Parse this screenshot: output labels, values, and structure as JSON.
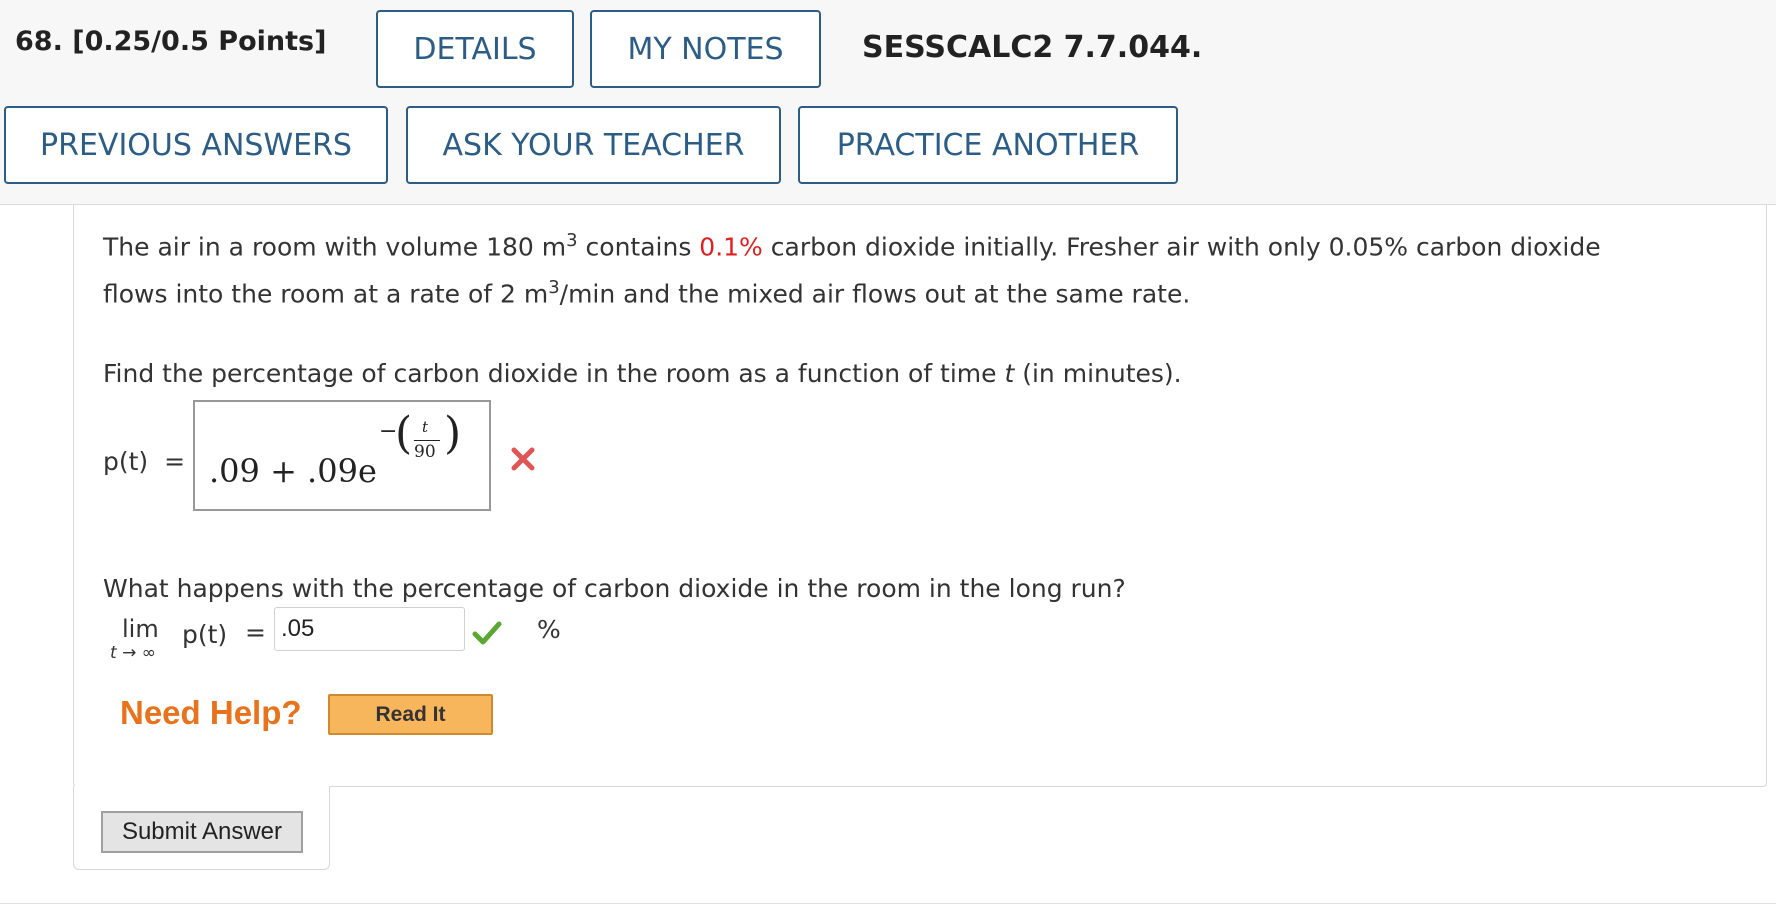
{
  "question": {
    "title": "68.  [0.25/0.5 Points]",
    "ref": "SESSCALC2 7.7.044."
  },
  "buttons": {
    "details": "DETAILS",
    "my_notes": "MY NOTES",
    "previous_answers": "PREVIOUS ANSWERS",
    "ask_teacher": "ASK YOUR TEACHER",
    "practice_another": "PRACTICE ANOTHER"
  },
  "problem": {
    "line1_a": "The air in a room with volume 180 m",
    "sup3": "3",
    "line1_b": " contains ",
    "initial_pct": "0.1%",
    "line1_c": " carbon dioxide initially. Fresher air with only 0.05% carbon dioxide",
    "line2_a": "flows into the room at a rate of 2 m",
    "line2_b": "/min and the mixed air flows out at the same rate."
  },
  "part1": {
    "prompt_a": "Find the percentage of carbon dioxide in the room as a function of time ",
    "prompt_t": "t",
    "prompt_b": " (in minutes).",
    "label": "p(t)",
    "equals": "=",
    "answer_base": ".09 + .09e",
    "exp_minus": "−",
    "exp_num": "t",
    "exp_den": "90",
    "status": "incorrect"
  },
  "part2": {
    "prompt": "What happens with the percentage of carbon dioxide in the room in the long run?",
    "lim": "lim",
    "lim_sub": "t → ∞",
    "func": "p(t)",
    "equals": "=",
    "answer": ".05",
    "unit": "%",
    "status": "correct"
  },
  "help": {
    "need_help": "Need Help?",
    "read_it": "Read It"
  },
  "submit_label": "Submit Answer",
  "colors": {
    "accent": "#2b5d86",
    "wrong": "#e05555",
    "correct": "#5aa832",
    "help_orange": "#e8731c",
    "read_btn": "#f7b55c"
  }
}
